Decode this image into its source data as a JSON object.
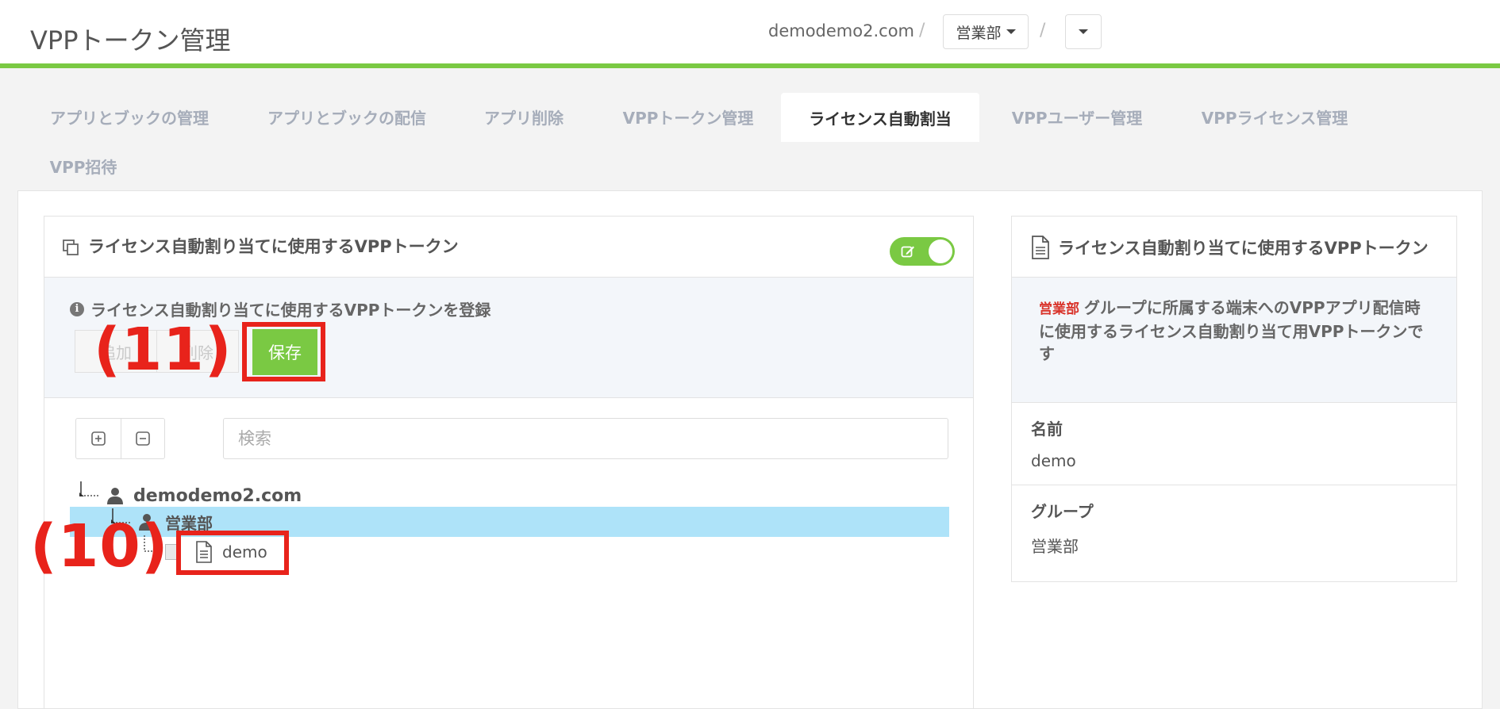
{
  "header": {
    "title": "VPPトークン管理",
    "breadcrumb_domain": "demodemo2.com",
    "breadcrumb_sep": "/",
    "group_dropdown": "営業部"
  },
  "tabs": [
    {
      "label": "アプリとブックの管理"
    },
    {
      "label": "アプリとブックの配信"
    },
    {
      "label": "アプリ削除"
    },
    {
      "label": "VPPトークン管理"
    },
    {
      "label": "ライセンス自動割当"
    },
    {
      "label": "VPPユーザー管理"
    },
    {
      "label": "VPPライセンス管理"
    },
    {
      "label": "VPP招待"
    }
  ],
  "active_tab": "ライセンス自動割当",
  "left_panel": {
    "title": "ライセンス自動割り当てに使用するVPPトークン",
    "info": "ライセンス自動割り当てに使用するVPPトークンを登録",
    "add_label": "追加",
    "delete_label": "削除",
    "save_label": "保存",
    "search_placeholder": "検索",
    "tree": {
      "root": "demodemo2.com",
      "group": "営業部",
      "leaf": "demo"
    }
  },
  "annotations": {
    "save": "(11)",
    "leaf": "(10)"
  },
  "right_panel": {
    "title": "ライセンス自動割り当てに使用するVPPトークン",
    "desc_group": "営業部",
    "desc_text": "グループに所属する端末へのVPPアプリ配信時に使用するライセンス自動割り当て用VPPトークンです",
    "name_label": "名前",
    "name_value": "demo",
    "group_label": "グループ",
    "group_value": "営業部"
  },
  "colors": {
    "accent_green": "#7ac943",
    "annotation_red": "#e8231b",
    "selection_blue": "#aee3f9"
  }
}
